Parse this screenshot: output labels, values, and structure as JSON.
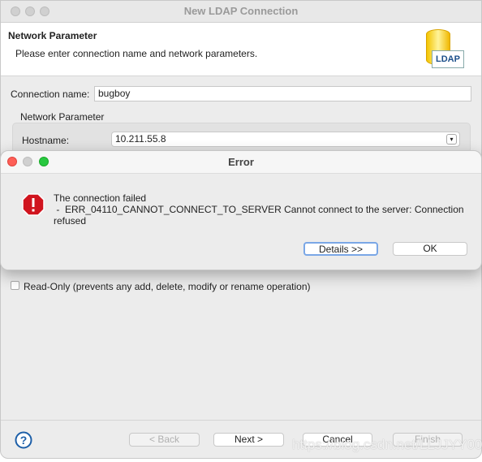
{
  "window": {
    "title": "New LDAP Connection"
  },
  "header": {
    "title": "Network Parameter",
    "subtitle": "Please enter connection name and network parameters.",
    "logo_text": "LDAP"
  },
  "form": {
    "connection_name_label": "Connection name:",
    "connection_name_value": "bugboy",
    "group_label": "Network Parameter",
    "hostname_label": "Hostname:",
    "hostname_value": "10.211.55.8",
    "readonly_label": "Read-Only (prevents any add, delete, modify or rename operation)",
    "readonly_checked": false
  },
  "error_dialog": {
    "title": "Error",
    "line1": "The connection failed",
    "line2": " -  ERR_04110_CANNOT_CONNECT_TO_SERVER Cannot connect to the server: Connection",
    "line3": "refused",
    "details_label": "Details >>",
    "ok_label": "OK",
    "icon": "error-stop-icon",
    "icon_color": "#d0141e"
  },
  "footer": {
    "back_label": "< Back",
    "next_label": "Next >",
    "cancel_label": "Cancel",
    "finish_label": "Finish"
  },
  "watermark": "https://blog.csdn.net/LLJJYY001"
}
